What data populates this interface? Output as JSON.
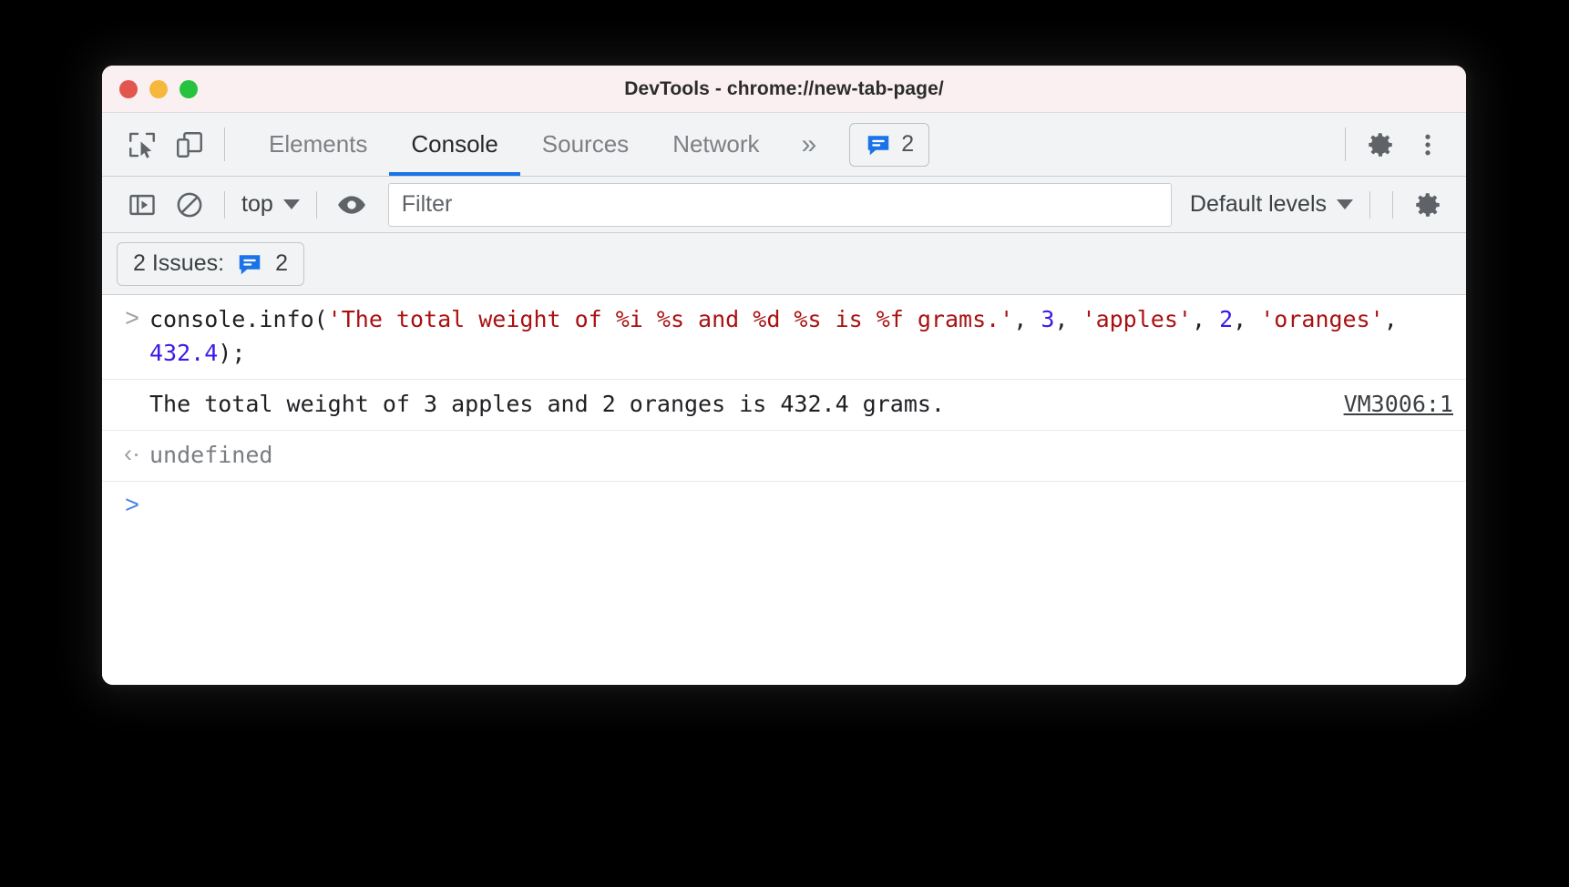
{
  "window": {
    "title": "DevTools - chrome://new-tab-page/",
    "traffic_lights": [
      {
        "name": "close",
        "color": "#e2564f"
      },
      {
        "name": "minimize",
        "color": "#f5b83d"
      },
      {
        "name": "maximize",
        "color": "#27c33f"
      }
    ]
  },
  "tab_bar": {
    "inspect_icon": "inspect-cursor-icon",
    "device_toggle_icon": "device-toggle-icon",
    "tabs": [
      {
        "label": "Elements",
        "active": false
      },
      {
        "label": "Console",
        "active": true
      },
      {
        "label": "Sources",
        "active": false
      },
      {
        "label": "Network",
        "active": false
      }
    ],
    "overflow_label": "»",
    "issues_badge": {
      "icon": "issues-message-icon",
      "count": "2",
      "color": "#1a73e8"
    },
    "settings_icon": "gear-icon",
    "more_icon": "kebab-menu-icon",
    "active_tab_underline_color": "#1a73e8"
  },
  "console_toolbar": {
    "sidebar_toggle_icon": "console-sidebar-toggle-icon",
    "clear_icon": "clear-console-icon",
    "context_label": "top",
    "eye_icon": "live-expression-eye-icon",
    "filter": {
      "value": "",
      "placeholder": "Filter"
    },
    "levels_label": "Default levels",
    "settings_icon": "gear-icon"
  },
  "issues_bar": {
    "label": "2 Issues:",
    "icon": "issues-message-icon",
    "count": "2"
  },
  "console": {
    "messages": [
      {
        "type": "input",
        "prompt": ">",
        "code_segments": [
          {
            "text": "console.info(",
            "token": "plain"
          },
          {
            "text": "'The total weight of %i %s and %d %s is %f grams.'",
            "token": "string"
          },
          {
            "text": ", ",
            "token": "plain"
          },
          {
            "text": "3",
            "token": "number"
          },
          {
            "text": ", ",
            "token": "plain"
          },
          {
            "text": "'apples'",
            "token": "string"
          },
          {
            "text": ", ",
            "token": "plain"
          },
          {
            "text": "2",
            "token": "number"
          },
          {
            "text": ", ",
            "token": "plain"
          },
          {
            "text": "'oranges'",
            "token": "string"
          },
          {
            "text": ", ",
            "token": "plain"
          },
          {
            "text": "432.4",
            "token": "number"
          },
          {
            "text": ");",
            "token": "plain"
          }
        ]
      },
      {
        "type": "output",
        "text": "The total weight of 3 apples and 2 oranges is 432.4 grams.",
        "source_link": "VM3006:1"
      },
      {
        "type": "result",
        "prompt": "‹·",
        "text": "undefined"
      },
      {
        "type": "prompt",
        "prompt": ">"
      }
    ]
  },
  "colors": {
    "accent": "#1a73e8",
    "string_token": "#aa1111",
    "number_token": "#3d18e8",
    "titlebar_bg": "#faf0f2",
    "toolbar_bg": "#f1f3f4",
    "console_bg": "#ffffff",
    "page_bg": "#000000"
  }
}
